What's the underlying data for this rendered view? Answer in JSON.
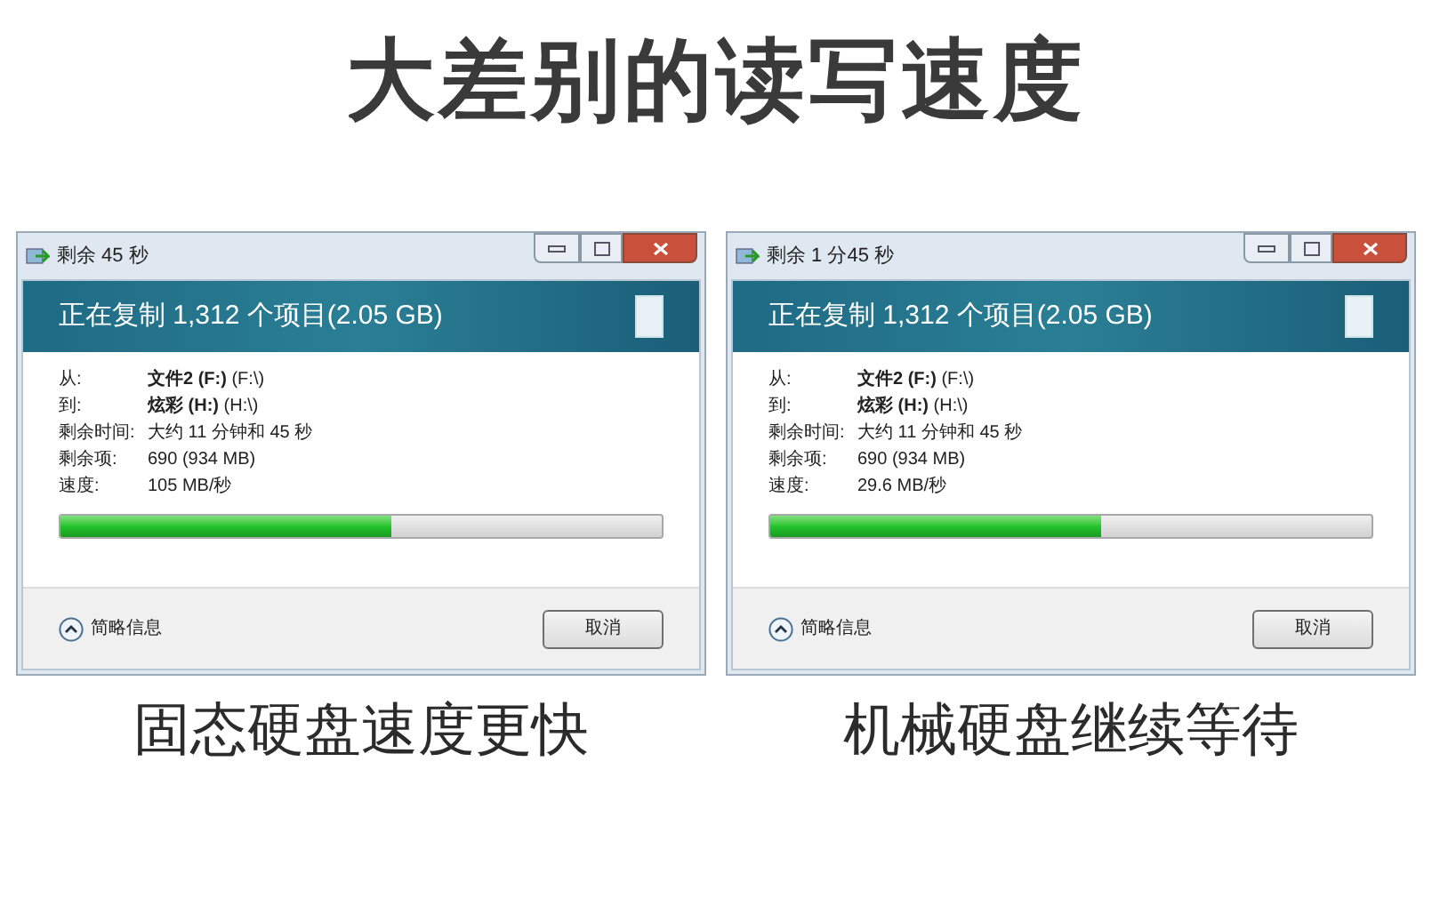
{
  "headline": "大差别的读写速度",
  "dialogs": [
    {
      "window_title": "剩余 45 秒",
      "header": "正在复制 1,312 个项目(2.05 GB)",
      "details": [
        {
          "label": "从:",
          "value": "**文件2 (F:)** (F:\\)"
        },
        {
          "label": "到:",
          "value": "**炫彩 (H:)** (H:\\)"
        },
        {
          "label": "剩余时间:",
          "value": "大约 11 分钟和 45 秒"
        },
        {
          "label": "剩余项:",
          "value": "690 (934 MB)"
        },
        {
          "label": "速度:",
          "value": "105 MB/秒"
        }
      ],
      "progress": {
        "level": 0.55
      },
      "details_toggle": "简略信息",
      "cancel_button": "取消",
      "caption": "固态硬盘速度更快"
    },
    {
      "window_title": "剩余 1 分45 秒",
      "header": "正在复制 1,312 个项目(2.05 GB)",
      "details": [
        {
          "label": "从:",
          "value": "**文件2 (F:)** (F:\\)"
        },
        {
          "label": "到:",
          "value": "**炫彩 (H:)** (H:\\)"
        },
        {
          "label": "剩余时间:",
          "value": "大约 11 分钟和 45 秒"
        },
        {
          "label": "剩余项:",
          "value": "690 (934 MB)"
        },
        {
          "label": "速度:",
          "value": "29.6 MB/秒"
        }
      ],
      "progress": {
        "level": 0.55
      },
      "details_toggle": "简略信息",
      "cancel_button": "取消",
      "caption": "机械硬盘继续等待"
    }
  ]
}
